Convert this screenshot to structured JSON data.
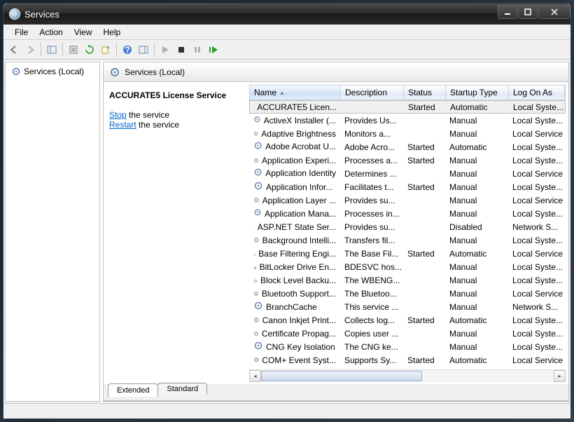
{
  "window": {
    "title": "Services"
  },
  "menu": {
    "file": "File",
    "action": "Action",
    "view": "View",
    "help": "Help"
  },
  "tree": {
    "root": "Services (Local)"
  },
  "header": {
    "title": "Services (Local)"
  },
  "detail": {
    "service_name": "ACCURATE5 License Service",
    "stop_link": "Stop",
    "stop_suffix": " the service",
    "restart_link": "Restart",
    "restart_suffix": " the service"
  },
  "columns": {
    "name": "Name",
    "description": "Description",
    "status": "Status",
    "startup": "Startup Type",
    "logon": "Log On As"
  },
  "tabs": {
    "extended": "Extended",
    "standard": "Standard"
  },
  "services": [
    {
      "name": "ACCURATE5 Licen...",
      "desc": "",
      "status": "Started",
      "startup": "Automatic",
      "logon": "Local Syste...",
      "selected": true
    },
    {
      "name": "ActiveX Installer (...",
      "desc": "Provides Us...",
      "status": "",
      "startup": "Manual",
      "logon": "Local Syste..."
    },
    {
      "name": "Adaptive Brightness",
      "desc": "Monitors a...",
      "status": "",
      "startup": "Manual",
      "logon": "Local Service"
    },
    {
      "name": "Adobe Acrobat U...",
      "desc": "Adobe Acro...",
      "status": "Started",
      "startup": "Automatic",
      "logon": "Local Syste..."
    },
    {
      "name": "Application Experi...",
      "desc": "Processes a...",
      "status": "Started",
      "startup": "Manual",
      "logon": "Local Syste..."
    },
    {
      "name": "Application Identity",
      "desc": "Determines ...",
      "status": "",
      "startup": "Manual",
      "logon": "Local Service"
    },
    {
      "name": "Application Infor...",
      "desc": "Facilitates t...",
      "status": "Started",
      "startup": "Manual",
      "logon": "Local Syste..."
    },
    {
      "name": "Application Layer ...",
      "desc": "Provides su...",
      "status": "",
      "startup": "Manual",
      "logon": "Local Service"
    },
    {
      "name": "Application Mana...",
      "desc": "Processes in...",
      "status": "",
      "startup": "Manual",
      "logon": "Local Syste..."
    },
    {
      "name": "ASP.NET State Ser...",
      "desc": "Provides su...",
      "status": "",
      "startup": "Disabled",
      "logon": "Network S..."
    },
    {
      "name": "Background Intelli...",
      "desc": "Transfers fil...",
      "status": "",
      "startup": "Manual",
      "logon": "Local Syste..."
    },
    {
      "name": "Base Filtering Engi...",
      "desc": "The Base Fil...",
      "status": "Started",
      "startup": "Automatic",
      "logon": "Local Service"
    },
    {
      "name": "BitLocker Drive En...",
      "desc": "BDESVC hos...",
      "status": "",
      "startup": "Manual",
      "logon": "Local Syste..."
    },
    {
      "name": "Block Level Backu...",
      "desc": "The WBENG...",
      "status": "",
      "startup": "Manual",
      "logon": "Local Syste..."
    },
    {
      "name": "Bluetooth Support...",
      "desc": "The Bluetoo...",
      "status": "",
      "startup": "Manual",
      "logon": "Local Service"
    },
    {
      "name": "BranchCache",
      "desc": "This service ...",
      "status": "",
      "startup": "Manual",
      "logon": "Network S..."
    },
    {
      "name": "Canon Inkjet Print...",
      "desc": "Collects log...",
      "status": "Started",
      "startup": "Automatic",
      "logon": "Local Syste..."
    },
    {
      "name": "Certificate Propag...",
      "desc": "Copies user ...",
      "status": "",
      "startup": "Manual",
      "logon": "Local Syste..."
    },
    {
      "name": "CNG Key Isolation",
      "desc": "The CNG ke...",
      "status": "",
      "startup": "Manual",
      "logon": "Local Syste..."
    },
    {
      "name": "COM+ Event Syst...",
      "desc": "Supports Sy...",
      "status": "Started",
      "startup": "Automatic",
      "logon": "Local Service"
    }
  ]
}
